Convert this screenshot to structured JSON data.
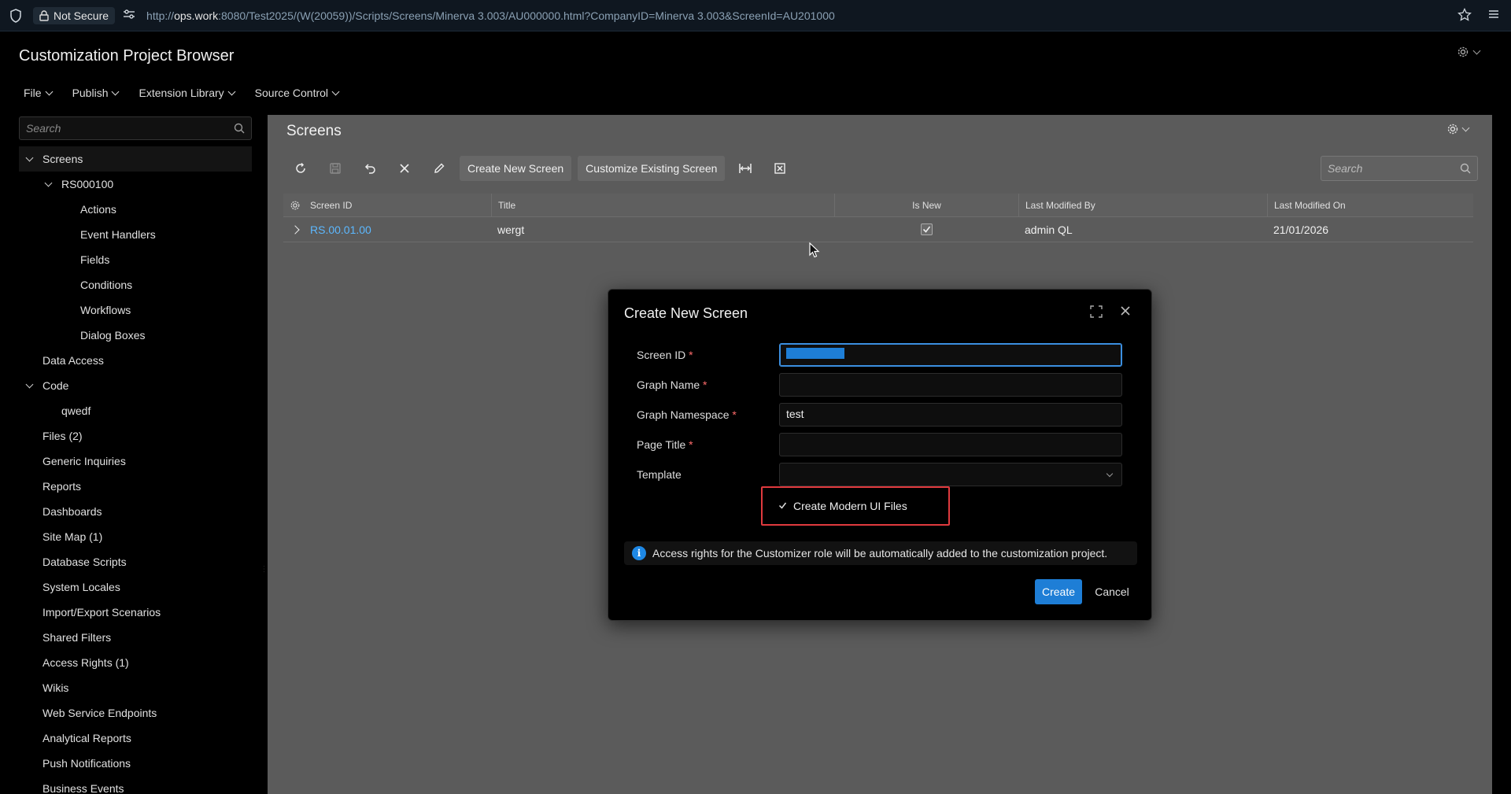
{
  "browser": {
    "security_label": "Not Secure",
    "url_prefix": "http://",
    "url_host": "ops.work",
    "url_rest": ":8080/Test2025/(W(20059))/Scripts/Screens/Minerva 3.003/AU000000.html?CompanyID=Minerva 3.003&ScreenId=AU201000"
  },
  "app": {
    "title": "Customization Project Browser",
    "menu": [
      {
        "label": "File"
      },
      {
        "label": "Publish"
      },
      {
        "label": "Extension Library"
      },
      {
        "label": "Source Control"
      }
    ]
  },
  "sidebar": {
    "search_placeholder": "Search",
    "tree": [
      {
        "label": "Screens",
        "level": 0,
        "expanded": true
      },
      {
        "label": "RS000100",
        "level": 1,
        "expanded": true
      },
      {
        "label": "Actions",
        "level": 2
      },
      {
        "label": "Event Handlers",
        "level": 2
      },
      {
        "label": "Fields",
        "level": 2
      },
      {
        "label": "Conditions",
        "level": 2
      },
      {
        "label": "Workflows",
        "level": 2
      },
      {
        "label": "Dialog Boxes",
        "level": 2
      },
      {
        "label": "Data Access",
        "level": 0
      },
      {
        "label": "Code",
        "level": 0,
        "expanded": true
      },
      {
        "label": "qwedf",
        "level": 1
      },
      {
        "label": "Files (2)",
        "level": 0
      },
      {
        "label": "Generic Inquiries",
        "level": 0
      },
      {
        "label": "Reports",
        "level": 0
      },
      {
        "label": "Dashboards",
        "level": 0
      },
      {
        "label": "Site Map (1)",
        "level": 0
      },
      {
        "label": "Database Scripts",
        "level": 0
      },
      {
        "label": "System Locales",
        "level": 0
      },
      {
        "label": "Import/Export Scenarios",
        "level": 0
      },
      {
        "label": "Shared Filters",
        "level": 0
      },
      {
        "label": "Access Rights (1)",
        "level": 0
      },
      {
        "label": "Wikis",
        "level": 0
      },
      {
        "label": "Web Service Endpoints",
        "level": 0
      },
      {
        "label": "Analytical Reports",
        "level": 0
      },
      {
        "label": "Push Notifications",
        "level": 0
      },
      {
        "label": "Business Events",
        "level": 0
      }
    ]
  },
  "content": {
    "title": "Screens",
    "toolbar": {
      "create_new_screen": "Create New Screen",
      "customize_existing_screen": "Customize Existing Screen"
    },
    "search_placeholder": "Search",
    "grid": {
      "columns": [
        "Screen ID",
        "Title",
        "Is New",
        "Last Modified By",
        "Last Modified On"
      ],
      "rows": [
        {
          "screen_id": "RS.00.01.00",
          "title": "wergt",
          "is_new": true,
          "modified_by": "admin QL",
          "modified_on": "21/01/2026"
        }
      ]
    }
  },
  "dialog": {
    "title": "Create New Screen",
    "fields": {
      "screen_id": {
        "label": "Screen ID",
        "value": ""
      },
      "graph_name": {
        "label": "Graph Name",
        "value": ""
      },
      "graph_namespace": {
        "label": "Graph Namespace",
        "value": "test"
      },
      "page_title": {
        "label": "Page Title",
        "value": ""
      },
      "template": {
        "label": "Template",
        "value": ""
      }
    },
    "required_mark": "*",
    "checkbox_label": "Create Modern UI Files",
    "checkbox_checked": true,
    "info_text": "Access rights for the Customizer role will be automatically added to the customization project.",
    "create_label": "Create",
    "cancel_label": "Cancel"
  },
  "colors": {
    "accent": "#1e7ed6",
    "link": "#5cb8ff",
    "highlight_border": "#e03a3e",
    "content_bg": "#5b5b5b"
  }
}
